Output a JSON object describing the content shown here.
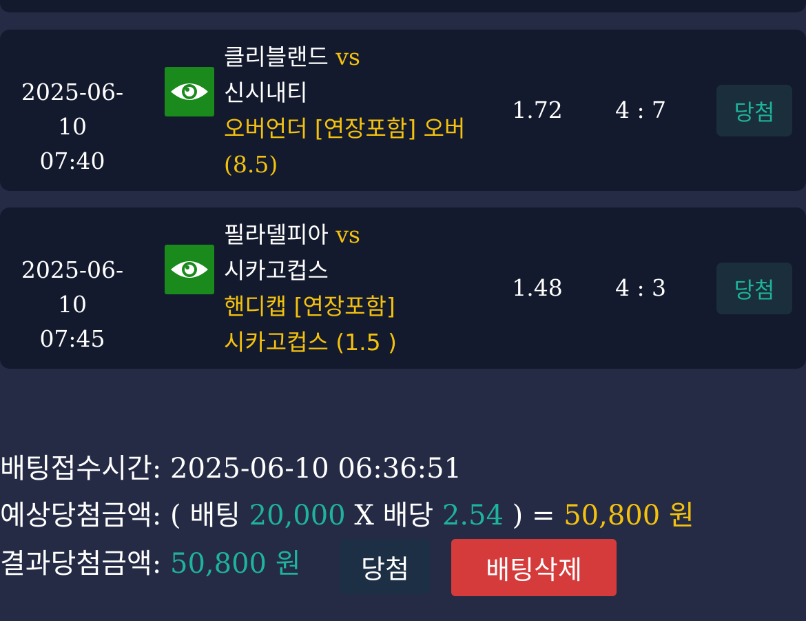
{
  "bets": [
    {
      "date": "2025-06-10",
      "time": "07:40",
      "home_team": "클리블랜드",
      "vs": "vs",
      "away_team": "신시내티",
      "pick_line1": "오버언더 [연장포함] 오버",
      "pick_line2": "(8.5)",
      "odds": "1.72",
      "score": "4 : 7",
      "result": "당첨",
      "view_icon": "eye-icon"
    },
    {
      "date": "2025-06-10",
      "time": "07:45",
      "home_team": "필라델피아",
      "vs": "vs",
      "away_team": "시카고컵스",
      "pick_line1": "핸디캡 [연장포함]",
      "pick_line2": "시카고컵스 (1.5 )",
      "odds": "1.48",
      "score": "4 : 3",
      "result": "당첨",
      "view_icon": "eye-icon"
    }
  ],
  "summary": {
    "bet_time_label": "배팅접수시간",
    "bet_time_value": "2025-06-10 06:36:51",
    "expected_label": "예상당첨금액",
    "expected_open": "(",
    "bet_word": "배팅",
    "bet_amount": "20,000",
    "multiply": "X",
    "odds_word": "배당",
    "total_odds": "2.54",
    "expected_close": ") =",
    "expected_amount": "50,800",
    "currency": "원",
    "result_label": "결과당첨금액",
    "result_amount": "50,800",
    "status": "당첨",
    "delete_label": "배팅삭제"
  },
  "colors": {
    "background": "#252b45",
    "card": "#141a2d",
    "accent_yellow": "#f4c20d",
    "accent_green": "#1eb39a",
    "eye_button": "#1a8a1d",
    "delete_button": "#d63b3b"
  }
}
